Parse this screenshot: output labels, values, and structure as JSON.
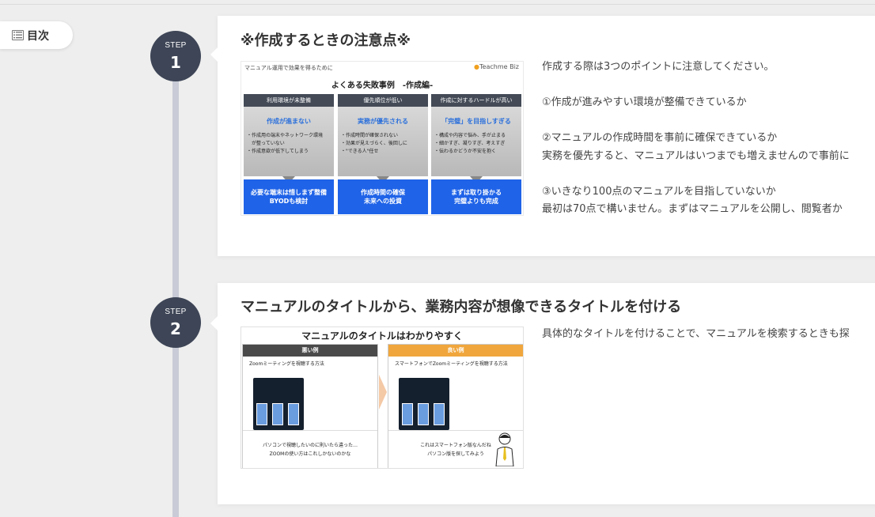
{
  "toc": {
    "label": "目次"
  },
  "steps": [
    {
      "step_label": "STEP",
      "number": "1",
      "title": "※作成するときの注意点※",
      "text": "作成する際は3つのポイントに注意してください。\n\n①作成が進みやすい環境が整備できているか\n\n②マニュアルの作成時間を事前に確保できているか\n実務を優先すると、マニュアルはいつまでも増えませんので事前に\n\n③いきなり100点のマニュアルを目指していないか\n最初は70点で構いません。まずはマニュアルを公開し、閲覧者か",
      "figure": {
        "top_note": "マニュアル運用で効果を得るために",
        "logo": "Teachme Biz",
        "title": "よくある失敗事例　-作成編-",
        "columns": [
          {
            "head": "利用環境が未整備",
            "sub": "作成が進まない",
            "list": "・作成用の端末やネットワーク環境\n　が整っていない\n・作成意欲が低下してしまう",
            "result": "必要な端末は惜しまず整備\nBYODも検討"
          },
          {
            "head": "優先順位が低い",
            "sub": "実務が優先される",
            "list": "・作成時間が確保されない\n・効果が見えづらく、後回しに\n・\"できる人\"任せ",
            "result": "作成時間の確保\n未来への投資"
          },
          {
            "head": "作成に対するハードルが高い",
            "sub": "「完璧」を目指しすぎる",
            "list": "・構成や内容で悩み、手が止まる\n・細かすぎ、凝りすぎ、考えすぎ\n・伝わるかどうか不安を抱く",
            "result": "まずは取り掛かる\n完璧よりも完成"
          }
        ]
      }
    },
    {
      "step_label": "STEP",
      "number": "2",
      "title": "マニュアルのタイトルから、業務内容が想像できるタイトルを付ける",
      "text": "具体的なタイトルを付けることで、マニュアルを検索するときも探",
      "figure": {
        "title": "マニュアルのタイトルはわかりやすく",
        "bad": {
          "head": "悪い例",
          "sub": "Zoomミーティングを視聴する方法",
          "foot": "パソコンで視聴したいのに則いたら違った…\nZOOMの使い方はこれしかないのかな"
        },
        "good": {
          "head": "良い例",
          "sub": "スマートフォンでZoomミーティングを視聴する方法",
          "foot": "これはスマートフォン版なんだね\nパソコン版を探してみよう"
        },
        "colors": {
          "bad": "#4a4a4a",
          "good": "#f0a63c"
        }
      }
    }
  ]
}
